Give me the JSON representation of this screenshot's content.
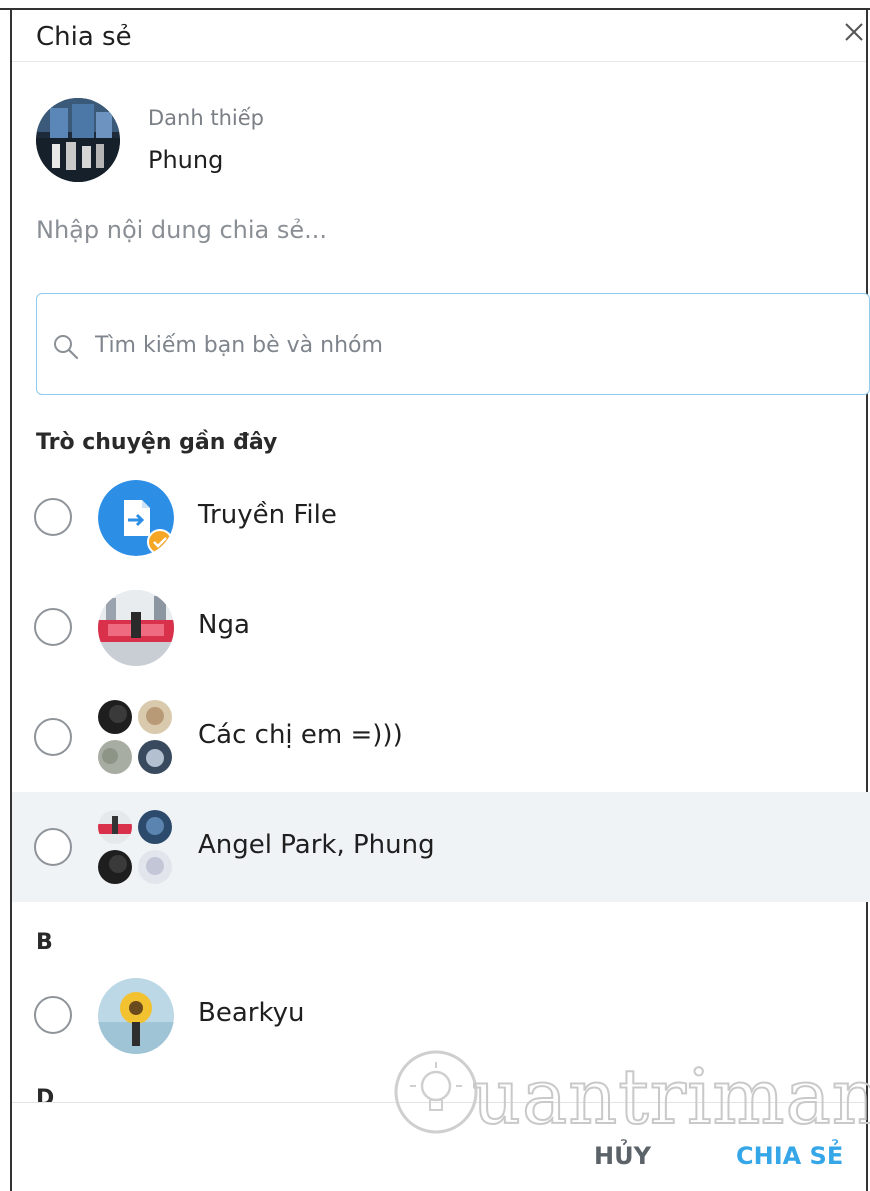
{
  "dialog": {
    "title": "Chia sẻ",
    "close_icon": "close-icon"
  },
  "card": {
    "label": "Danh thiếp",
    "name": "Phung"
  },
  "message": {
    "placeholder": "Nhập nội dung chia sẻ..."
  },
  "search": {
    "icon": "search-icon",
    "placeholder": "Tìm kiếm bạn bè và nhóm"
  },
  "sections": {
    "recent": "Trò chuyện gần đây",
    "b": "B",
    "next_partial": "D"
  },
  "recent_chats": [
    {
      "name": "Truyền File",
      "avatar": "file-transfer-icon"
    },
    {
      "name": "Nga",
      "avatar": "photo"
    },
    {
      "name": "Các chị em =)))",
      "avatar": "group-photos"
    },
    {
      "name": "Angel Park, Phung",
      "avatar": "group-photos",
      "highlighted": true
    }
  ],
  "contacts_b": [
    {
      "name": "Bearkyu",
      "avatar": "photo"
    }
  ],
  "footer": {
    "cancel_label": "HỦY",
    "share_label": "CHIA SẺ"
  },
  "watermark": {
    "text": "uantrimang"
  },
  "colors": {
    "accent": "#35a6e8",
    "search_border": "#8fcbee",
    "highlight_row": "#f0f3f6",
    "cancel_text": "#5b6268"
  }
}
